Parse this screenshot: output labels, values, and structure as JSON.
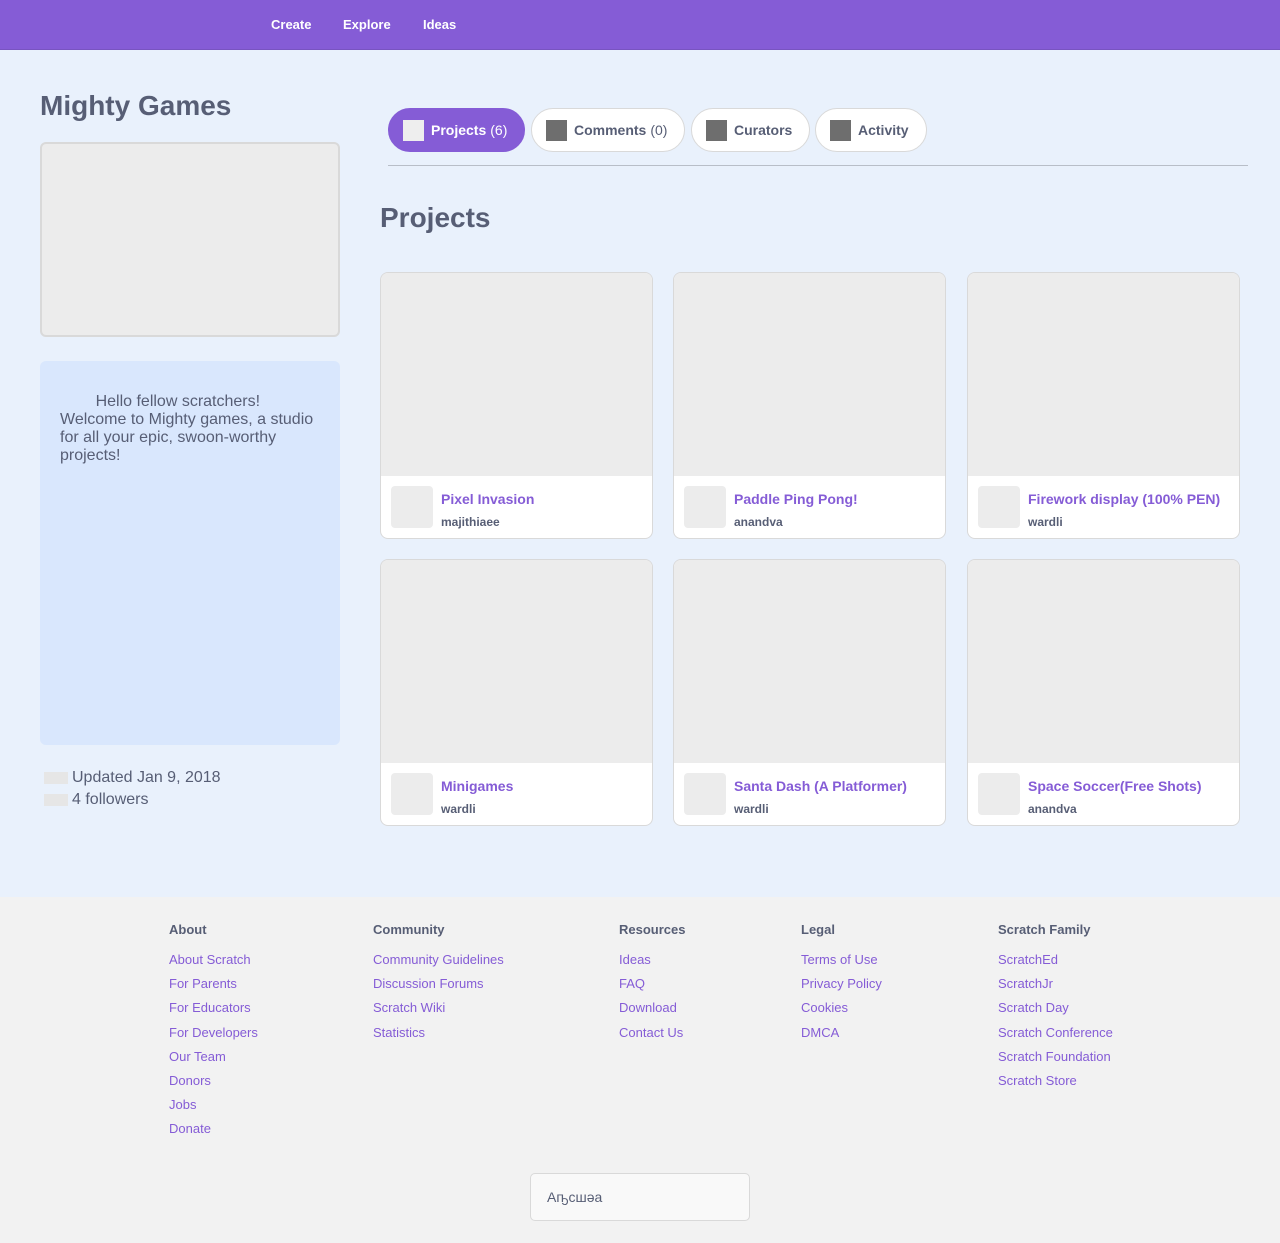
{
  "nav": {
    "create": "Create",
    "explore": "Explore",
    "ideas": "Ideas"
  },
  "studio": {
    "title": "Mighty Games",
    "description": "        Hello fellow scratchers!\nWelcome to Mighty games, a studio for all your epic, swoon-worthy projects!",
    "updated": "Updated Jan 9, 2018",
    "followers": "4 followers"
  },
  "tabs": [
    {
      "label": "Projects",
      "count": "(6)"
    },
    {
      "label": "Comments",
      "count": "(0)"
    },
    {
      "label": "Curators",
      "count": ""
    },
    {
      "label": "Activity",
      "count": ""
    }
  ],
  "section_title": "Projects",
  "projects": [
    {
      "title": "Pixel Invasion",
      "author": "majithiaee"
    },
    {
      "title": "Paddle Ping Pong!",
      "author": "anandva"
    },
    {
      "title": "Firework display (100% PEN)",
      "author": "wardli"
    },
    {
      "title": "Minigames",
      "author": "wardli"
    },
    {
      "title": "Santa Dash (A Platformer)",
      "author": "wardli"
    },
    {
      "title": "Space Soccer(Free Shots)",
      "author": "anandva"
    }
  ],
  "footer": {
    "about": {
      "heading": "About",
      "links": [
        "About Scratch",
        "For Parents",
        "For Educators",
        "For Developers",
        "Our Team",
        "Donors",
        "Jobs",
        "Donate"
      ]
    },
    "community": {
      "heading": "Community",
      "links": [
        "Community Guidelines",
        "Discussion Forums",
        "Scratch Wiki",
        "Statistics"
      ]
    },
    "resources": {
      "heading": "Resources",
      "links": [
        "Ideas",
        "FAQ",
        "Download",
        "Contact Us"
      ]
    },
    "legal": {
      "heading": "Legal",
      "links": [
        "Terms of Use",
        "Privacy Policy",
        "Cookies",
        "DMCA"
      ]
    },
    "family": {
      "heading": "Scratch Family",
      "links": [
        "ScratchEd",
        "ScratchJr",
        "Scratch Day",
        "Scratch Conference",
        "Scratch Foundation",
        "Scratch Store"
      ]
    },
    "language": "Аҧсшәа"
  }
}
